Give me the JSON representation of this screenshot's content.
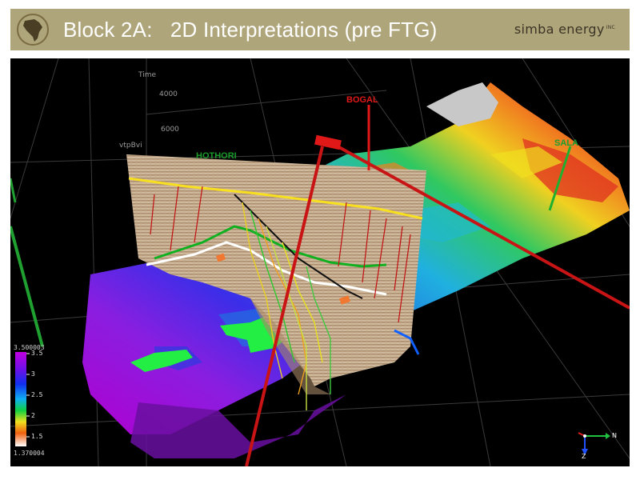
{
  "header": {
    "title": "Block 2A:   2D Interpretations (pre FTG)",
    "brand": "simba energy",
    "brand_suffix": "INC"
  },
  "scene": {
    "axis_time_label": "Time",
    "depth_4000": "4000",
    "depth_6000": "6000",
    "section_label": "vtpBvi"
  },
  "wells": [
    {
      "name": "BOGAL",
      "color": "#e01818"
    },
    {
      "name": "HOTHORI",
      "color": "#1a9a2a"
    },
    {
      "name": "SALA",
      "color": "#1aa030"
    }
  ],
  "legend": {
    "max_value": "3.500003",
    "min_value": "1.370004",
    "ticks": [
      "3.5",
      "3",
      "2.5",
      "2",
      "1.5"
    ]
  },
  "orientation": {
    "north": "N",
    "z": "Z"
  },
  "colors": {
    "header_bg": "#afa57a",
    "viewport_bg": "#000000"
  }
}
